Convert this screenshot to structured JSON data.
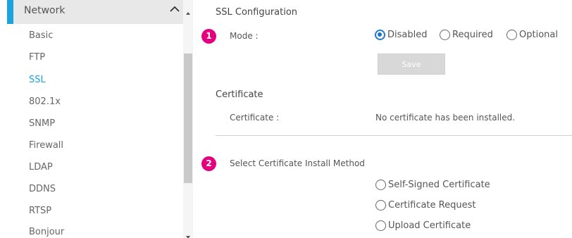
{
  "colors": {
    "accent": "#1ba3dd",
    "badge": "#e4007f",
    "selected_radio": "#1a73c9"
  },
  "sidebar": {
    "header": {
      "title": "Network",
      "icon": "chevron-up-icon"
    },
    "items": [
      {
        "label": "Basic"
      },
      {
        "label": "FTP"
      },
      {
        "label": "SSL",
        "active": true
      },
      {
        "label": "802.1x"
      },
      {
        "label": "SNMP"
      },
      {
        "label": "Firewall"
      },
      {
        "label": "LDAP"
      },
      {
        "label": "DDNS"
      },
      {
        "label": "RTSP"
      },
      {
        "label": "Bonjour"
      }
    ]
  },
  "ssl_config": {
    "title": "SSL Configuration",
    "step_badge": "1",
    "mode_label": "Mode :",
    "mode_options": [
      {
        "label": "Disabled",
        "selected": true
      },
      {
        "label": "Required",
        "selected": false
      },
      {
        "label": "Optional",
        "selected": false
      }
    ],
    "save_label": "Save"
  },
  "certificate": {
    "title": "Certificate",
    "label": "Certificate :",
    "value": "No certificate has been installed."
  },
  "install_method": {
    "step_badge": "2",
    "label": "Select Certificate Install Method",
    "options": [
      {
        "label": "Self-Signed Certificate",
        "selected": false
      },
      {
        "label": "Certificate Request",
        "selected": false
      },
      {
        "label": "Upload Certificate",
        "selected": false
      }
    ]
  }
}
